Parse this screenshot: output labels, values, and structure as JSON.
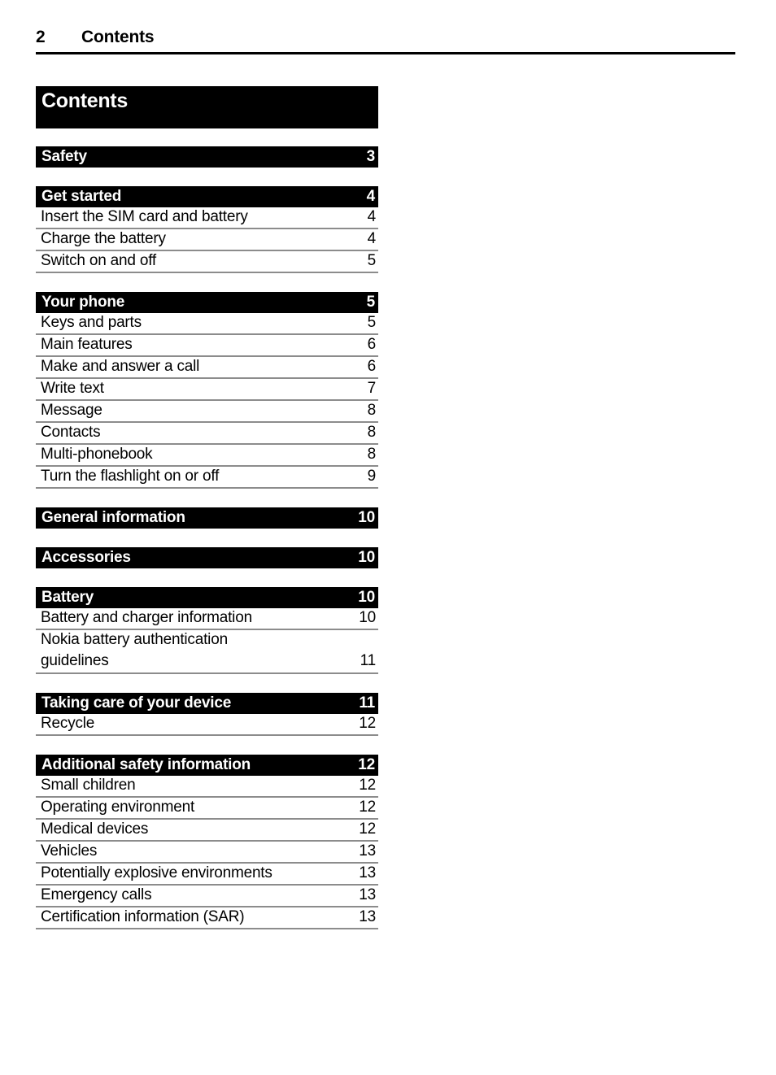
{
  "header": {
    "folio": "2",
    "title": "Contents"
  },
  "toc": {
    "title": "Contents",
    "chapters": [
      {
        "title": "Safety",
        "page": "3",
        "entries": []
      },
      {
        "title": "Get started",
        "page": "4",
        "entries": [
          {
            "label": "Insert the SIM card and battery",
            "page": "4"
          },
          {
            "label": "Charge the battery",
            "page": "4"
          },
          {
            "label": "Switch on and off",
            "page": "5"
          }
        ]
      },
      {
        "title": "Your phone",
        "page": "5",
        "entries": [
          {
            "label": "Keys and parts",
            "page": "5"
          },
          {
            "label": "Main features",
            "page": "6"
          },
          {
            "label": "Make and answer a call",
            "page": "6"
          },
          {
            "label": "Write text",
            "page": "7"
          },
          {
            "label": "Message",
            "page": "8"
          },
          {
            "label": "Contacts",
            "page": "8"
          },
          {
            "label": "Multi-phonebook",
            "page": "8"
          },
          {
            "label": "Turn the flashlight on or off",
            "page": "9"
          }
        ]
      },
      {
        "title": "General information",
        "page": "10",
        "entries": []
      },
      {
        "title": "Accessories",
        "page": "10",
        "entries": []
      },
      {
        "title": "Battery",
        "page": "10",
        "entries": [
          {
            "label": "Battery and charger information",
            "page": "10"
          },
          {
            "label": "Nokia battery authentication\nguidelines",
            "page": "11",
            "two_line": true
          }
        ]
      },
      {
        "title": "Taking care of your device",
        "page": "11",
        "entries": [
          {
            "label": "Recycle",
            "page": "12"
          }
        ]
      },
      {
        "title": "Additional safety information",
        "page": "12",
        "entries": [
          {
            "label": "Small children",
            "page": "12"
          },
          {
            "label": "Operating environment",
            "page": "12"
          },
          {
            "label": "Medical devices",
            "page": "12"
          },
          {
            "label": "Vehicles",
            "page": "13"
          },
          {
            "label": "Potentially explosive environments",
            "page": "13"
          },
          {
            "label": "Emergency calls",
            "page": "13"
          },
          {
            "label": "Certification information (SAR)",
            "page": "13"
          }
        ]
      }
    ]
  },
  "colors": {
    "band": "#000000",
    "rule": "#8c8c8c",
    "text": "#000000",
    "band_text": "#ffffff"
  }
}
